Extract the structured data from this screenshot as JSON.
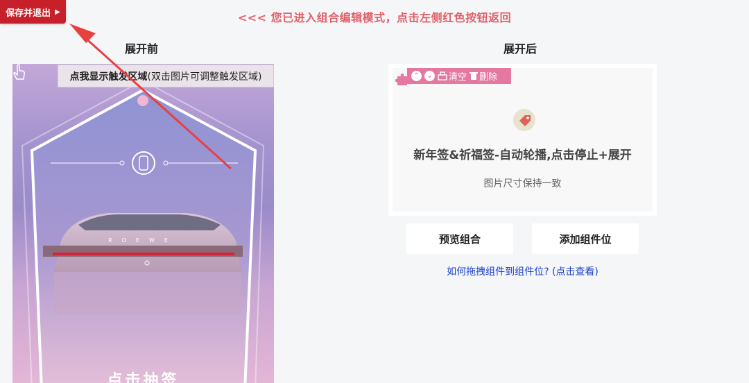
{
  "save_exit": {
    "label": "保存并退出",
    "arrow": "▶"
  },
  "notice": "<<< 您已进入组合编辑模式，点击左侧红色按钮返回",
  "before": {
    "title": "展开前",
    "hint_main": "点我显示触发区域",
    "hint_sub": "(双击图片可调整触发区域)",
    "tap_label": "点击抽签"
  },
  "after": {
    "title": "展开后",
    "toolbar": {
      "clear": "清空",
      "delete": "删除"
    },
    "component_title": "新年签&祈福签-自动轮播,点击停止+展开",
    "component_sub": "图片尺寸保持一致"
  },
  "buttons": {
    "preview": "预览组合",
    "add_slot": "添加组件位"
  },
  "help_link": "如何拖拽组件到组件位? (点击查看)",
  "colors": {
    "accent_red": "#c8202a",
    "toolbar_pink": "#e478a0",
    "link_blue": "#1a3fd0"
  }
}
